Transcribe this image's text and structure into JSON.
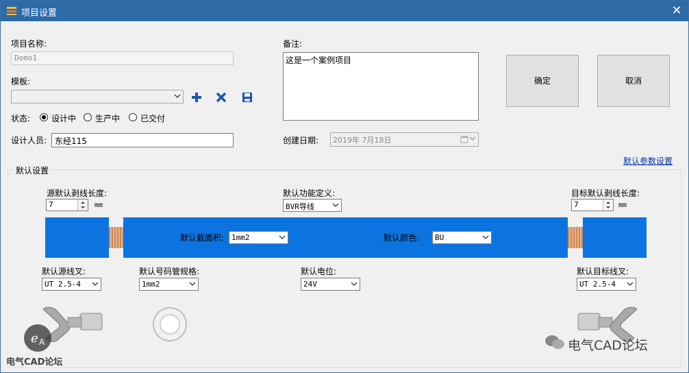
{
  "window": {
    "title": "项目设置",
    "close_glyph": "✕"
  },
  "project": {
    "name_label": "项目名称:",
    "name_value": "Demo1",
    "template_label": "模板:",
    "template_value": "",
    "status_label": "状态:",
    "status_options": [
      "设计中",
      "生产中",
      "已交付"
    ],
    "status_selected": "设计中",
    "designer_label": "设计人员:",
    "designer_value": "东经115"
  },
  "notes": {
    "label": "备注:",
    "value": "这是一个案例项目"
  },
  "created": {
    "label": "创建日期:",
    "value": "2019年  7月18日"
  },
  "buttons": {
    "ok": "确定",
    "cancel": "取消"
  },
  "defaults": {
    "group_title": "默认设置",
    "param_link": "默认参数设置",
    "src_strip_label": "源默认剥线长度:",
    "src_strip_value": "7",
    "dst_strip_label": "目标默认剥线长度:",
    "dst_strip_value": "7",
    "unit": "mm",
    "function_label": "默认功能定义:",
    "function_value": "BVR导线",
    "cross_label": "默认截面积:",
    "cross_value": "1mm2",
    "color_label": "默认颜色:",
    "color_value": "BU",
    "src_terminal_label": "默认源线叉:",
    "src_terminal_value": "UT 2.5-4",
    "tube_label": "默认号码管规格:",
    "tube_value": "1mm2",
    "potential_label": "默认电位:",
    "potential_value": "24V",
    "dst_terminal_label": "默认目标线叉:",
    "dst_terminal_value": "UT 2.5-4"
  },
  "watermarks": {
    "bottom_left": "电气CAD论坛",
    "bottom_right": "电气CAD论坛"
  },
  "colors": {
    "title_bar": "#2e6ba6",
    "wire": "#0b74e0",
    "link": "#0033aa"
  },
  "icons": [
    "app-icon",
    "close-icon",
    "add-icon",
    "delete-icon",
    "save-icon",
    "chevron-down-icon",
    "calendar-icon"
  ]
}
